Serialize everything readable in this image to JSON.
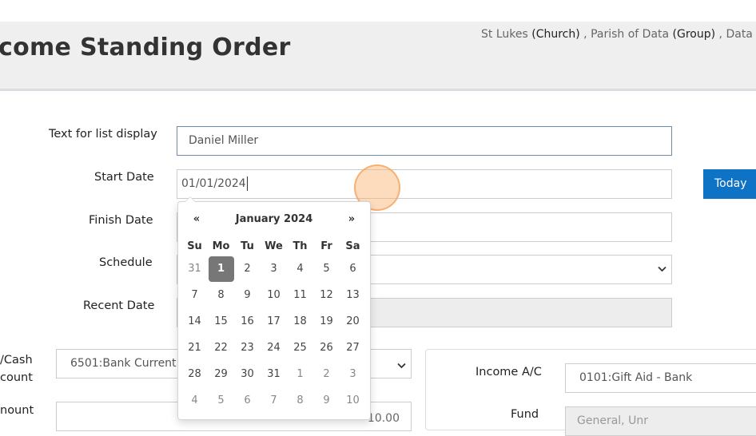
{
  "header": {
    "title": "come Standing Order",
    "context": [
      {
        "name": "St Lukes",
        "type": "(Church)"
      },
      {
        "name": "Parish of Data",
        "type": "(Group)"
      },
      {
        "name": "Data Do",
        "type": ""
      }
    ],
    "context_sep": " , "
  },
  "form": {
    "text_for_list_label": "Text for list display",
    "text_for_list_value": "Daniel Miller",
    "start_date_label": "Start Date",
    "start_date_value": "01/01/2024",
    "today_button": "Today",
    "finish_date_label": "Finish Date",
    "finish_date_value": "",
    "schedule_label": "Schedule",
    "schedule_value": "",
    "recent_date_label": "Recent Date",
    "recent_date_value": "",
    "bank_cash_label_line1": "/Cash",
    "bank_cash_label_line2": "count",
    "bank_cash_value": "6501:Bank Current",
    "amount_label": "nount",
    "amount_value": "10.00",
    "income_ac_label": "Income A/C",
    "income_ac_value": "0101:Gift Aid - Bank",
    "fund_label": "Fund",
    "fund_value": "General, Unr"
  },
  "datepicker": {
    "prev": "«",
    "next": "»",
    "month_year": "January 2024",
    "weekdays": [
      "Su",
      "Mo",
      "Tu",
      "We",
      "Th",
      "Fr",
      "Sa"
    ],
    "weeks": [
      [
        {
          "d": "31",
          "o": true
        },
        {
          "d": "1",
          "a": true
        },
        {
          "d": "2"
        },
        {
          "d": "3"
        },
        {
          "d": "4"
        },
        {
          "d": "5"
        },
        {
          "d": "6"
        }
      ],
      [
        {
          "d": "7"
        },
        {
          "d": "8"
        },
        {
          "d": "9"
        },
        {
          "d": "10"
        },
        {
          "d": "11"
        },
        {
          "d": "12"
        },
        {
          "d": "13"
        }
      ],
      [
        {
          "d": "14"
        },
        {
          "d": "15"
        },
        {
          "d": "16"
        },
        {
          "d": "17"
        },
        {
          "d": "18"
        },
        {
          "d": "19"
        },
        {
          "d": "20"
        }
      ],
      [
        {
          "d": "21"
        },
        {
          "d": "22"
        },
        {
          "d": "23"
        },
        {
          "d": "24"
        },
        {
          "d": "25"
        },
        {
          "d": "26"
        },
        {
          "d": "27"
        }
      ],
      [
        {
          "d": "28"
        },
        {
          "d": "29"
        },
        {
          "d": "30"
        },
        {
          "d": "31"
        },
        {
          "d": "1",
          "o": true
        },
        {
          "d": "2",
          "o": true
        },
        {
          "d": "3",
          "o": true
        }
      ],
      [
        {
          "d": "4",
          "o": true
        },
        {
          "d": "5",
          "o": true
        },
        {
          "d": "6",
          "o": true
        },
        {
          "d": "7",
          "o": true
        },
        {
          "d": "8",
          "o": true
        },
        {
          "d": "9",
          "o": true
        },
        {
          "d": "10",
          "o": true
        }
      ]
    ]
  },
  "icons": {
    "select_chevron": "chevron-down-icon"
  }
}
